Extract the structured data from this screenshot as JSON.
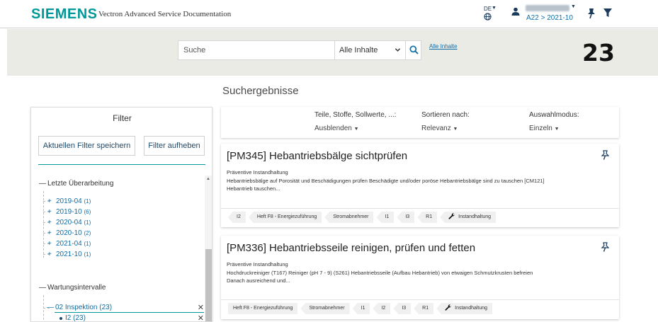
{
  "header": {
    "brand": "SIEMENS",
    "app_title": "Vectron Advanced Service Documentation",
    "language": "DE",
    "user_context": "A22 > 2021-10"
  },
  "search": {
    "placeholder": "Suche",
    "scope": "Alle Inhalte",
    "all_content_link": "Alle Inhalte",
    "result_count": "23"
  },
  "results_title": "Suchergebnisse",
  "filter": {
    "title": "Filter",
    "save_label": "Aktuellen Filter speichern",
    "clear_label": "Filter aufheben",
    "section_revision": "Letzte Überarbeitung",
    "revisions": [
      {
        "label": "2019-04",
        "count": "(1)"
      },
      {
        "label": "2019-10",
        "count": "(6)"
      },
      {
        "label": "2020-04",
        "count": "(1)"
      },
      {
        "label": "2020-10",
        "count": "(2)"
      },
      {
        "label": "2021-04",
        "count": "(1)"
      },
      {
        "label": "2021-10",
        "count": "(1)"
      }
    ],
    "section_intervals": "Wartungsintervalle",
    "active_interval": "02 Inspektion (23)",
    "active_leaf": "I2 (23)"
  },
  "options": {
    "parts_label": "Teile, Stoffe, Sollwerte, ...:",
    "parts_value": "Ausblenden",
    "sort_label": "Sortieren nach:",
    "sort_value": "Relevanz",
    "mode_label": "Auswahlmodus:",
    "mode_value": "Einzeln"
  },
  "results": [
    {
      "title": "[PM345] Hebantriebsbälge sichtprüfen",
      "category": "Präventive Instandhaltung",
      "description": "Hebantriebsbälge auf Porosität und Beschädigungen prüfen Beschädigte und/oder poröse Hebantriebsbälge sind zu tauschen [CM121] Hebantrieb tauschen...",
      "tags": [
        "I2",
        "Heft F8 - Energiezuführung",
        "Stromabnehmer",
        "I1",
        "I3",
        "R1",
        "Instandhaltung"
      ]
    },
    {
      "title": "[PM336] Hebantriebsseile reinigen, prüfen und fetten",
      "category": "Präventive Instandhaltung",
      "description": "Hochdruckreiniger (T167) Reiniger (pH 7 - 9) (S261) Hebantriebsseile (Aufbau Hebantrieb) von etwaigen Schmutzkrusten befreien Danach ausreichend und...",
      "tags": [
        "Heft F8 - Energiezuführung",
        "Stromabnehmer",
        "I1",
        "I2",
        "I3",
        "R1",
        "Instandhaltung"
      ]
    }
  ],
  "colors": {
    "brand_teal": "#009999",
    "link_blue": "#0e6ea8",
    "band_gray": "#ebebe5",
    "navy": "#1a3a5c"
  }
}
